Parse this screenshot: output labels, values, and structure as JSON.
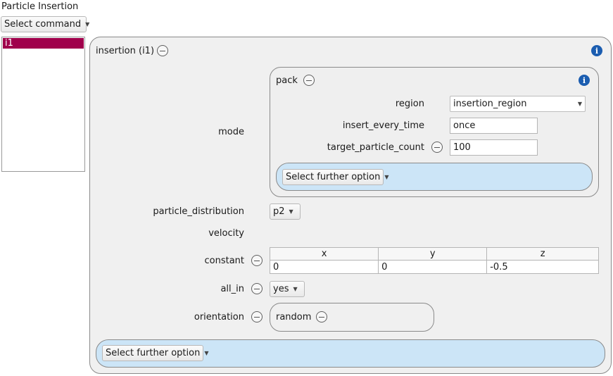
{
  "panel_title": "Particle Insertion",
  "select_command": "Select command",
  "list_items": [
    "i1"
  ],
  "insertion": {
    "title": "insertion (i1)",
    "mode_label": "mode",
    "pack": {
      "title": "pack",
      "region_label": "region",
      "region_value": "insertion_region",
      "insert_every_time_label": "insert_every_time",
      "insert_every_time_value": "once",
      "target_particle_count_label": "target_particle_count",
      "target_particle_count_value": "100",
      "further_option": "Select further option"
    },
    "particle_distribution_label": "particle_distribution",
    "particle_distribution_value": "p2",
    "velocity_label": "velocity",
    "constant_label": "constant",
    "vector_headers": [
      "x",
      "y",
      "z"
    ],
    "vector_values": [
      "0",
      "0",
      "-0.5"
    ],
    "all_in_label": "all_in",
    "all_in_value": "yes",
    "orientation_label": "orientation",
    "orientation_value": "random",
    "further_option": "Select further option"
  },
  "colors": {
    "selected_item": "#a0004c",
    "option_bar": "#cce5f7",
    "group_bg": "#f0f0f0",
    "info": "#1b5db0"
  }
}
